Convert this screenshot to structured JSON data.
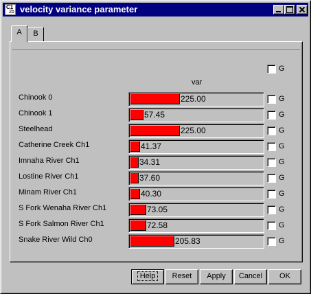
{
  "window": {
    "title": "velocity variance parameter",
    "icon_top": "C1",
    "icon_bottom": "2b"
  },
  "tabs": [
    {
      "label": "A",
      "selected": true
    },
    {
      "label": "B",
      "selected": false
    }
  ],
  "header": {
    "global_g_label": "G",
    "column_label": "var"
  },
  "rows": [
    {
      "label": "Chinook 0",
      "value": "225.00",
      "fraction": 0.37,
      "g_label": "G"
    },
    {
      "label": "Chinook 1",
      "value": "57.45",
      "fraction": 0.1,
      "g_label": "G"
    },
    {
      "label": "Steelhead",
      "value": "225.00",
      "fraction": 0.37,
      "g_label": "G"
    },
    {
      "label": "Catherine Creek Ch1",
      "value": "41.37",
      "fraction": 0.07,
      "g_label": "G"
    },
    {
      "label": "Imnaha River Ch1",
      "value": "34.31",
      "fraction": 0.06,
      "g_label": "G"
    },
    {
      "label": "Lostine River Ch1",
      "value": "37.60",
      "fraction": 0.06,
      "g_label": "G"
    },
    {
      "label": "Minam River Ch1",
      "value": "40.30",
      "fraction": 0.07,
      "g_label": "G"
    },
    {
      "label": "S Fork Wenaha River Ch1",
      "value": "73.05",
      "fraction": 0.12,
      "g_label": "G"
    },
    {
      "label": "S Fork Salmon River Ch1",
      "value": "72.58",
      "fraction": 0.12,
      "g_label": "G"
    },
    {
      "label": "Snake River Wild Ch0",
      "value": "205.83",
      "fraction": 0.33,
      "g_label": "G"
    }
  ],
  "buttons": {
    "help": "Help",
    "reset": "Reset",
    "apply": "Apply",
    "cancel": "Cancel",
    "ok": "OK"
  },
  "colors": {
    "bar": "#ff0000",
    "titlebar": "#000080",
    "face": "#c0c0c0"
  }
}
